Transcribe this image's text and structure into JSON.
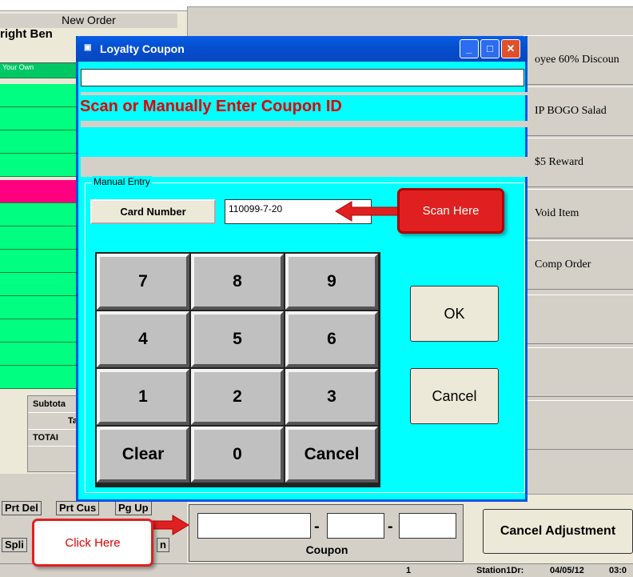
{
  "background": {
    "new_order": "New Order",
    "customer": "right Ben",
    "list_header": "Your Own",
    "right_buttons": [
      "oyee 60% Discoun",
      "IP BOGO Salad",
      "$5 Reward",
      "Void Item",
      "Comp Order"
    ],
    "subtotal_labels": [
      "Subtota",
      "Ta",
      "TOTAI"
    ],
    "toolbar": {
      "prt_del": "Prt Del",
      "prt_cus": "Prt Cus",
      "pg_up": "Pg Up",
      "split": "Spli",
      "n": "n"
    },
    "coupon_label": "Coupon",
    "coupon_dash": "-",
    "cancel_adjustment": "Cancel Adjustment",
    "status": {
      "field1": "1",
      "station": "Station1Dr:",
      "date": "04/05/12",
      "time": "03:0"
    }
  },
  "dialog": {
    "title": "Loyalty Coupon",
    "prompt": "Scan or Manually Enter Coupon ID",
    "manual_entry_label": "Manual Entry",
    "card_number_label": "Card Number",
    "card_number_value": "110099-7-20",
    "keys": [
      "7",
      "8",
      "9",
      "4",
      "5",
      "6",
      "1",
      "2",
      "3",
      "Clear",
      "0",
      "Cancel"
    ],
    "ok": "OK",
    "cancel": "Cancel",
    "window_buttons": {
      "minimize": "_",
      "maximize": "□",
      "close": "✕"
    }
  },
  "annotations": {
    "scan_here": "Scan Here",
    "click_here": "Click Here"
  },
  "colors": {
    "dialog_bg": "#00ffff",
    "prompt": "#e00000",
    "list_green": "#00ff80",
    "list_pink": "#ff0080",
    "callout": "#e02020"
  }
}
